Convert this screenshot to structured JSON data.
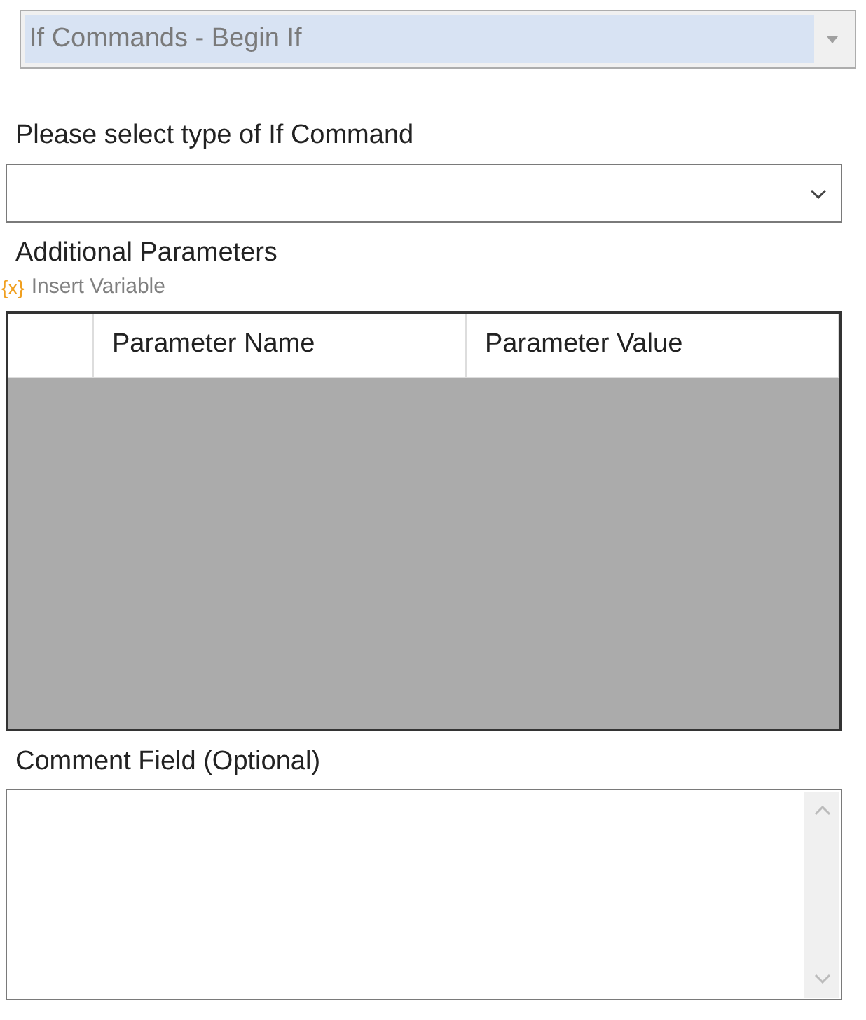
{
  "command_dropdown": {
    "value": "If Commands - Begin If",
    "disabled": true
  },
  "if_type": {
    "label": "Please select type of If Command"
  },
  "parameters": {
    "label": "Additional Parameters",
    "insert_variable": {
      "icon": "{x}",
      "label": "Insert Variable"
    },
    "table": {
      "columns": [
        "Parameter Name",
        "Parameter Value"
      ]
    }
  },
  "comment": {
    "label": "Comment Field (Optional)"
  }
}
